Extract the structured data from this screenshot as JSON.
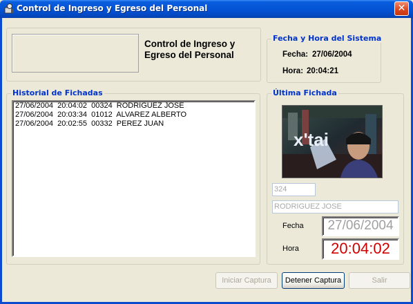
{
  "window": {
    "title": "Control de Ingreso y Egreso del Personal",
    "close_icon": "close-icon"
  },
  "header": {
    "title": "Control de Ingreso y Egreso del Personal"
  },
  "system_datetime": {
    "legend": "Fecha y Hora del Sistema",
    "fecha_label": "Fecha:",
    "fecha_value": "27/06/2004",
    "hora_label": "Hora:",
    "hora_value": "20:04:21"
  },
  "history": {
    "legend": "Historial de Fichadas",
    "items": [
      "27/06/2004  20:04:02  00324  RODRIGUEZ JOSE",
      "27/06/2004  20:03:34  01012  ALVAREZ ALBERTO",
      "27/06/2004  20:02:55  00332  PEREZ JUAN"
    ]
  },
  "last_punch": {
    "legend": "Última Fichada",
    "photo_text": "x'tai",
    "employee_number": "324",
    "employee_name": "RODRIGUEZ JOSE",
    "fecha_label": "Fecha",
    "fecha_value": "27/06/2004",
    "hora_label": "Hora",
    "hora_value": "20:04:02"
  },
  "buttons": {
    "start_capture": "Iniciar Captura",
    "stop_capture": "Detener Captura",
    "exit": "Salir"
  },
  "colors": {
    "titlebar": "#0453D6",
    "legend": "#0033CC",
    "hora_value": "#D00000"
  }
}
